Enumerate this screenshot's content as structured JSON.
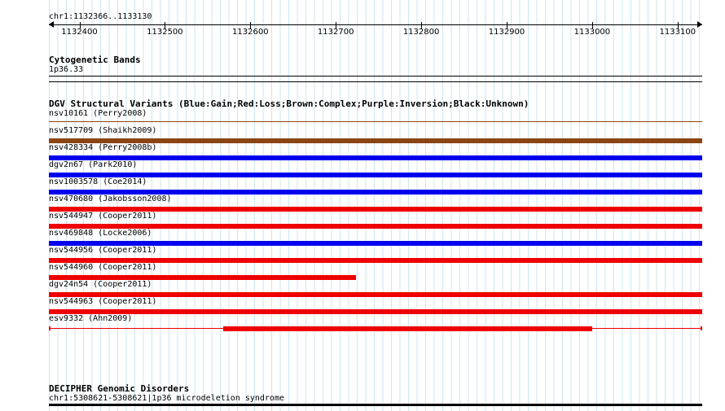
{
  "ruler": {
    "label": "chr1:1132366..1133130",
    "ticks": [
      "1132400",
      "1132500",
      "1132600",
      "1132700",
      "1132800",
      "1132900",
      "1133000",
      "1133100"
    ]
  },
  "cytogenetic_bands": {
    "title": "Cytogenetic Bands",
    "band": "1p36.33"
  },
  "dgv": {
    "title": "DGV Structural Variants (Blue:Gain;Red:Loss;Brown:Complex;Purple:Inversion;Black:Unknown)",
    "legend_colors": {
      "gain": "#0000ee",
      "loss": "#ee0000",
      "complex": "#8b4513",
      "inversion": "#800080",
      "unknown": "#000000"
    },
    "variants": [
      {
        "label": "nsv10161 (Perry2008)",
        "type": "complex"
      },
      {
        "label": "nsv517709 (Shaikh2009)",
        "type": "complex"
      },
      {
        "label": "nsv428334 (Perry2008b)",
        "type": "gain"
      },
      {
        "label": "dgv2n67 (Park2010)",
        "type": "gain"
      },
      {
        "label": "nsv1003578 (Coe2014)",
        "type": "gain"
      },
      {
        "label": "nsv470680 (Jakobsson2008)",
        "type": "loss"
      },
      {
        "label": "nsv544947 (Cooper2011)",
        "type": "loss"
      },
      {
        "label": "nsv469848 (Locke2006)",
        "type": "gain"
      },
      {
        "label": "nsv544956 (Cooper2011)",
        "type": "loss"
      },
      {
        "label": "nsv544960 (Cooper2011)",
        "type": "loss"
      },
      {
        "label": "dgv24n54 (Cooper2011)",
        "type": "loss"
      },
      {
        "label": "nsv544963 (Cooper2011)",
        "type": "loss"
      },
      {
        "label": "esv9332 (Ahn2009)",
        "type": "loss"
      }
    ]
  },
  "decipher": {
    "title": "DECIPHER Genomic Disorders",
    "item": "chr1:5308621-5308621|1p36 microdeletion syndrome"
  }
}
